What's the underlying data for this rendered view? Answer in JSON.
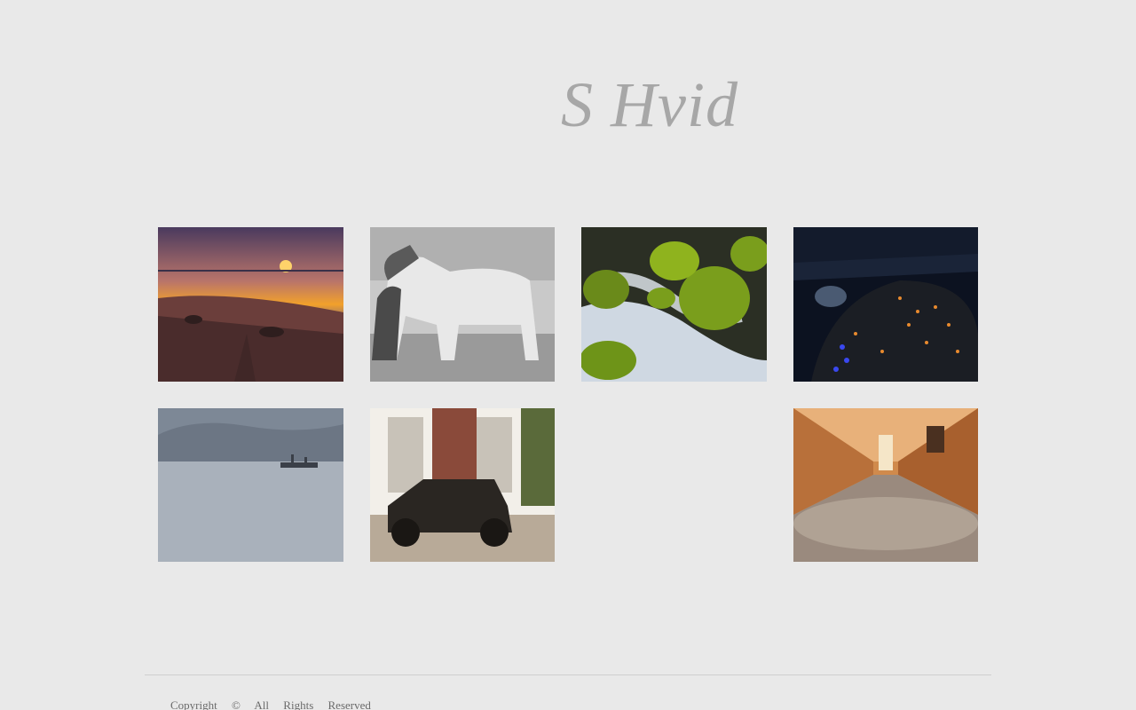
{
  "site": {
    "title": "S Hvid"
  },
  "gallery": {
    "photos": [
      {
        "name": "beach-sunset",
        "colors": [
          "#3d3457",
          "#f2a12b",
          "#6b3e3b"
        ]
      },
      {
        "name": "white-horses",
        "colors": [
          "#d6d6d6",
          "#9a9a9a",
          "#4a4a4a"
        ]
      },
      {
        "name": "mossy-stream",
        "colors": [
          "#7a9e1c",
          "#cfd8e2",
          "#2b2f24"
        ]
      },
      {
        "name": "city-night-aerial",
        "colors": [
          "#0c1220",
          "#e88a2e",
          "#2e3bd6"
        ]
      },
      {
        "name": "misty-lake-boat",
        "colors": [
          "#8d98a6",
          "#b7bfc9",
          "#3a3f48"
        ]
      },
      {
        "name": "vintage-car",
        "colors": [
          "#e8e2d8",
          "#8a4a3a",
          "#2a2622"
        ]
      },
      {
        "name": "cathedral-interior",
        "colors": [
          "#d08a4c",
          "#f0c79a",
          "#6a4a3a"
        ]
      }
    ]
  },
  "footer": {
    "copyright": "Copyright",
    "symbol": "©",
    "all": "All",
    "rights": "Rights",
    "reserved": "Reserved"
  }
}
